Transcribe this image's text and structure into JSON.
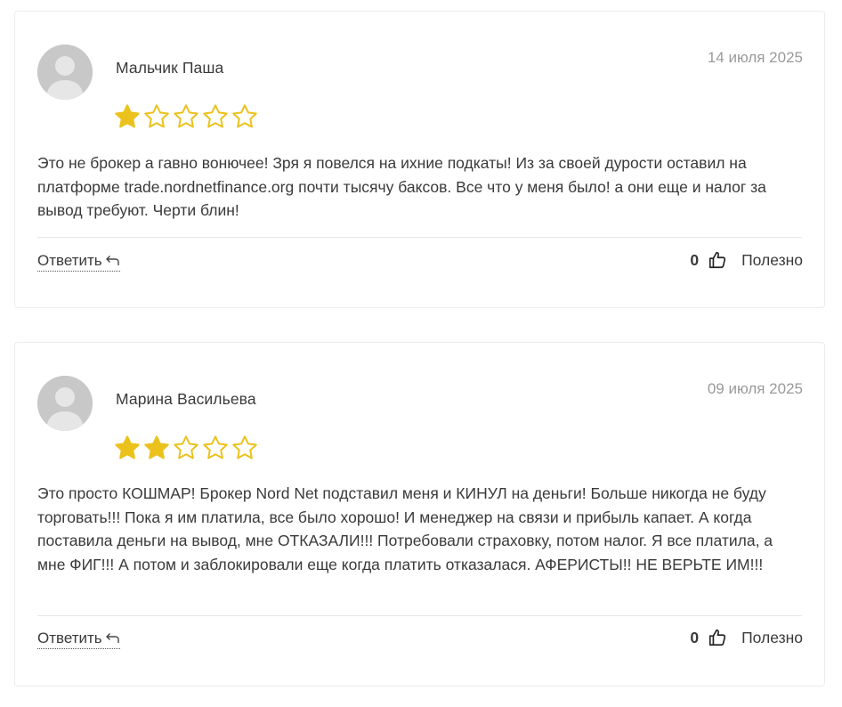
{
  "colors": {
    "star_filled": "#EBC21C",
    "star_empty_outline": "#EBC21C",
    "avatar_bg": "#C8C8C8",
    "text": "#3A3A3A",
    "date": "#9A9A9A"
  },
  "reviews": [
    {
      "author": "Мальчик Паша",
      "date": "14 июля 2025",
      "rating": 1,
      "rating_max": 5,
      "text": "Это не брокер а гавно вонючее! Зря я повелся на ихние подкаты! Из за своей дурости оставил на платформе trade.nordnetfinance.org почти тысячу баксов. Все что у меня было! а они еще и налог за вывод требуют. Черти блин!",
      "reply_label": "Ответить",
      "helpful_count": "0",
      "helpful_label": "Полезно"
    },
    {
      "author": "Марина Васильева",
      "date": "09 июля 2025",
      "rating": 2,
      "rating_max": 5,
      "text": "Это просто КОШМАР! Брокер Nord Net подставил меня и КИНУЛ на деньги! Больше никогда не буду торговать!!! Пока я им платила, все было хорошо! И менеджер на связи и прибыль капает. А когда поставила деньги на вывод, мне ОТКАЗАЛИ!!! Потребовали страховку, потом налог. Я все платила, а мне ФИГ!!! А потом и заблокировали еще когда платить отказалася. АФЕРИСТЫ!! НЕ ВЕРЬТЕ ИМ!!!",
      "reply_label": "Ответить",
      "helpful_count": "0",
      "helpful_label": "Полезно"
    }
  ]
}
